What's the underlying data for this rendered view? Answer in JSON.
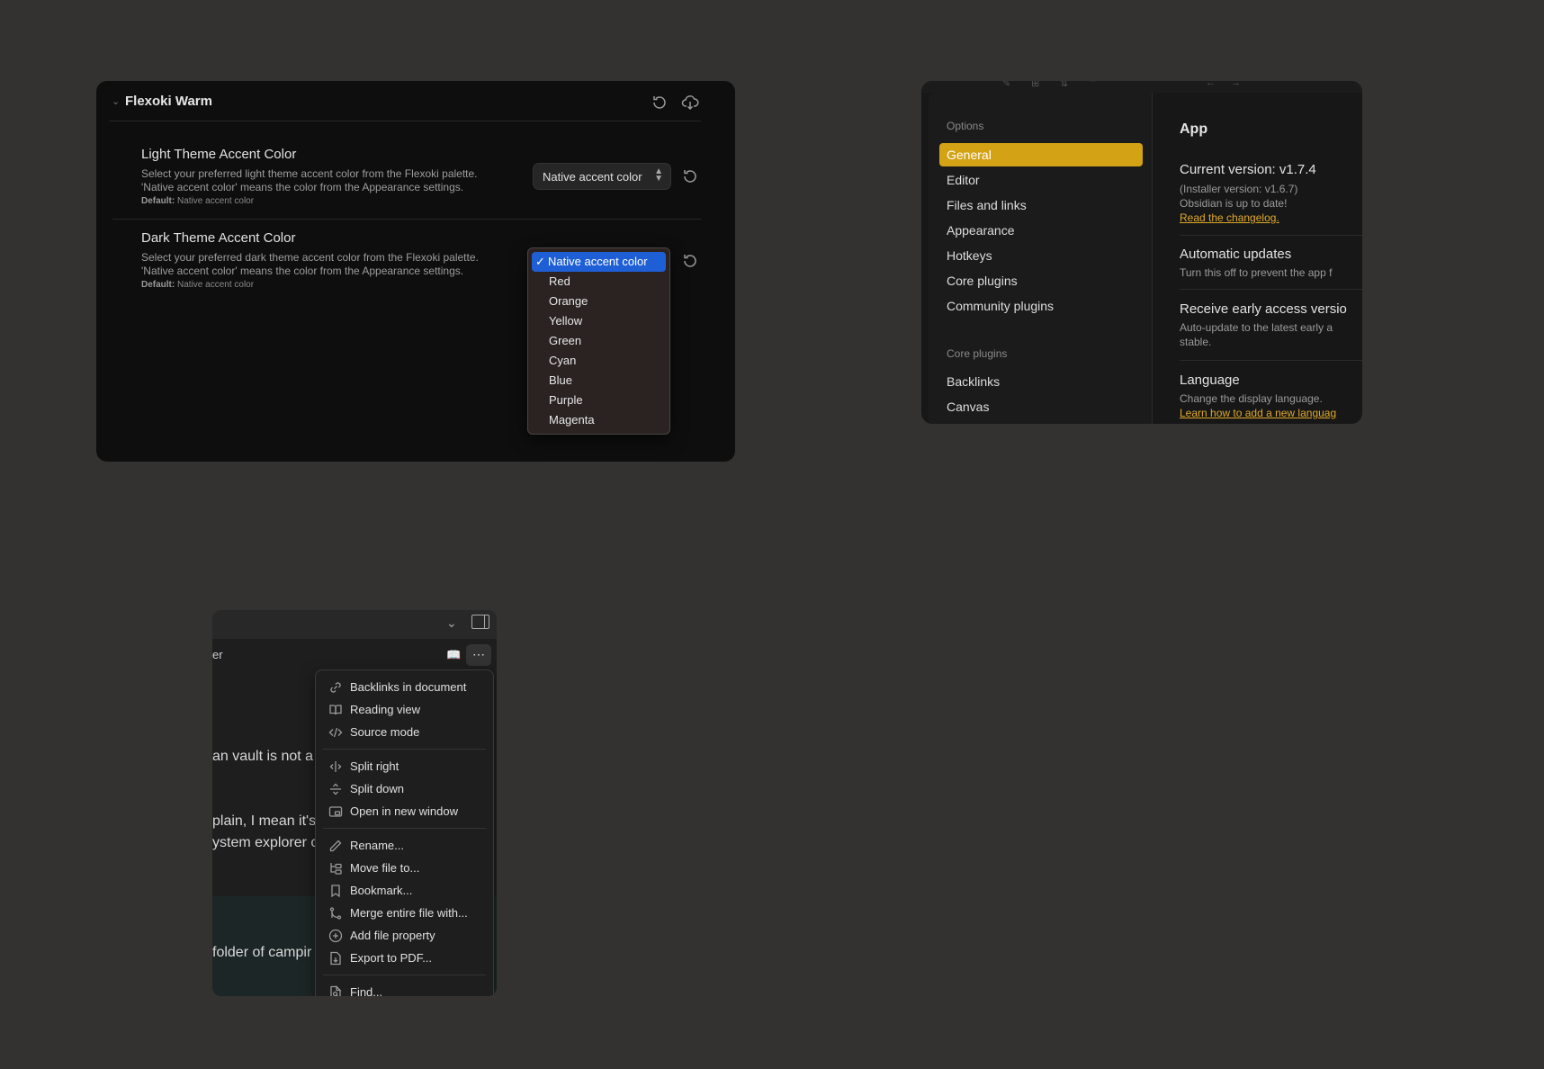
{
  "theme_panel": {
    "title": "Flexoki Warm",
    "light": {
      "name": "Light Theme Accent Color",
      "desc1": "Select your preferred light theme accent color from the Flexoki palette.",
      "desc2": "'Native accent color' means the color from the Appearance settings.",
      "default_label": "Default:",
      "default_value": "Native accent color",
      "select_value": "Native accent color"
    },
    "dark": {
      "name": "Dark Theme Accent Color",
      "desc1": "Select your preferred dark theme accent color from the Flexoki palette.",
      "desc2": "'Native accent color' means the color from the Appearance settings.",
      "default_label": "Default:",
      "default_value": "Native accent color",
      "options": [
        "Native accent color",
        "Red",
        "Orange",
        "Yellow",
        "Green",
        "Cyan",
        "Blue",
        "Purple",
        "Magenta"
      ],
      "selected": "Native accent color"
    },
    "icons": [
      "reset-icon",
      "cloud-download-icon"
    ]
  },
  "settings_panel": {
    "options_heading": "Options",
    "options": [
      "General",
      "Editor",
      "Files and links",
      "Appearance",
      "Hotkeys",
      "Core plugins",
      "Community plugins"
    ],
    "active": "General",
    "core_heading": "Core plugins",
    "core": [
      "Backlinks",
      "Canvas"
    ],
    "main": {
      "heading": "App",
      "version_title": "Current version: v1.7.4",
      "installer": "(Installer version: v1.6.7)",
      "up_to_date": "Obsidian is up to date!",
      "changelog": "Read the changelog.",
      "auto_title": "Automatic updates",
      "auto_desc": "Turn this off to prevent the app f",
      "early_title": "Receive early access versio",
      "early_desc1": "Auto-update to the latest early a",
      "early_desc2": "stable.",
      "lang_title": "Language",
      "lang_desc": "Change the display language.",
      "lang_link": "Learn how to add a new languag"
    },
    "accent_color": "#d4a215"
  },
  "menu_panel": {
    "crumb": "er",
    "text1": "an vault is not a",
    "text2": "plain, I mean it's",
    "text3": "ystem explorer c",
    "text4": "folder of campir",
    "more": "⋯",
    "groups": [
      [
        {
          "label": "Backlinks in document",
          "icon": "backlinks-icon"
        },
        {
          "label": "Reading view",
          "icon": "book-open-icon"
        },
        {
          "label": "Source mode",
          "icon": "code-icon"
        }
      ],
      [
        {
          "label": "Split right",
          "icon": "split-right-icon"
        },
        {
          "label": "Split down",
          "icon": "split-down-icon"
        },
        {
          "label": "Open in new window",
          "icon": "new-window-icon"
        }
      ],
      [
        {
          "label": "Rename...",
          "icon": "pencil-icon"
        },
        {
          "label": "Move file to...",
          "icon": "move-file-icon"
        },
        {
          "label": "Bookmark...",
          "icon": "bookmark-icon"
        },
        {
          "label": "Merge entire file with...",
          "icon": "merge-icon"
        },
        {
          "label": "Add file property",
          "icon": "plus-circle-icon"
        },
        {
          "label": "Export to PDF...",
          "icon": "export-pdf-icon"
        }
      ],
      [
        {
          "label": "Find...",
          "icon": "search-file-icon"
        }
      ]
    ]
  }
}
